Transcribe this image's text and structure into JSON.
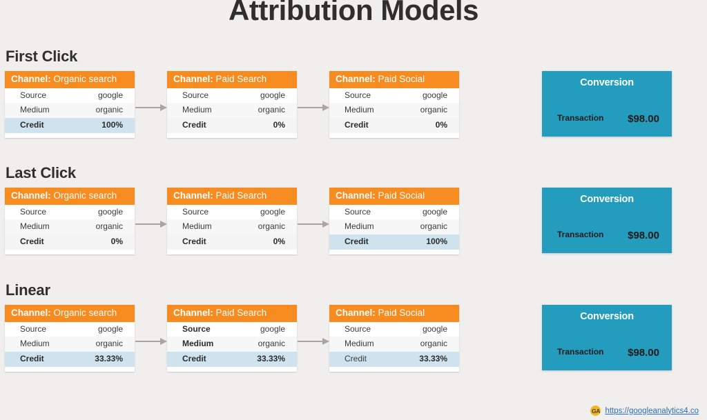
{
  "title": "Attribution Models",
  "footer": {
    "icon_label": "GA",
    "link_text": "https://googleanalytics4.co"
  },
  "colors": {
    "background": "#f0efee",
    "channel_header": "#f68b1f",
    "conversion": "#249cbe",
    "credit_highlight": "#cfe3ee",
    "arrow": "#a6a6a6",
    "link": "#2a6ebb",
    "ga_icon": "#f5b81c"
  },
  "conversion": {
    "title": "Conversion",
    "row_label": "Transaction",
    "row_value": "$98.00"
  },
  "card_labels": {
    "channel_prefix": "Channel:",
    "source": "Source",
    "medium": "Medium",
    "credit": "Credit"
  },
  "sections": [
    {
      "heading": "First Click",
      "cards": [
        {
          "channel": "Organic search",
          "source": "google",
          "medium": "organic",
          "credit": "100%",
          "credit_highlight": true,
          "source_bold": false,
          "medium_bold": false,
          "credit_label_bold": true
        },
        {
          "channel": "Paid Search",
          "source": "google",
          "medium": "organic",
          "credit": "0%",
          "credit_highlight": false,
          "source_bold": false,
          "medium_bold": false,
          "credit_label_bold": true
        },
        {
          "channel": "Paid Social",
          "source": "google",
          "medium": "organic",
          "credit": "0%",
          "credit_highlight": false,
          "source_bold": false,
          "medium_bold": false,
          "credit_label_bold": true
        }
      ]
    },
    {
      "heading": "Last Click",
      "cards": [
        {
          "channel": "Organic search",
          "source": "google",
          "medium": "organic",
          "credit": "0%",
          "credit_highlight": false,
          "source_bold": false,
          "medium_bold": false,
          "credit_label_bold": true
        },
        {
          "channel": "Paid Search",
          "source": "google",
          "medium": "organic",
          "credit": "0%",
          "credit_highlight": false,
          "source_bold": false,
          "medium_bold": false,
          "credit_label_bold": true
        },
        {
          "channel": "Paid Social",
          "source": "google",
          "medium": "organic",
          "credit": "100%",
          "credit_highlight": true,
          "source_bold": false,
          "medium_bold": false,
          "credit_label_bold": true
        }
      ]
    },
    {
      "heading": "Linear",
      "cards": [
        {
          "channel": "Organic search",
          "source": "google",
          "medium": "organic",
          "credit": "33.33%",
          "credit_highlight": true,
          "source_bold": false,
          "medium_bold": false,
          "credit_label_bold": true
        },
        {
          "channel": "Paid Search",
          "source": "google",
          "medium": "organic",
          "credit": "33.33%",
          "credit_highlight": true,
          "source_bold": true,
          "medium_bold": true,
          "credit_label_bold": true
        },
        {
          "channel": "Paid Social",
          "source": "google",
          "medium": "organic",
          "credit": "33.33%",
          "credit_highlight": true,
          "source_bold": false,
          "medium_bold": false,
          "credit_label_bold": false
        }
      ]
    }
  ]
}
